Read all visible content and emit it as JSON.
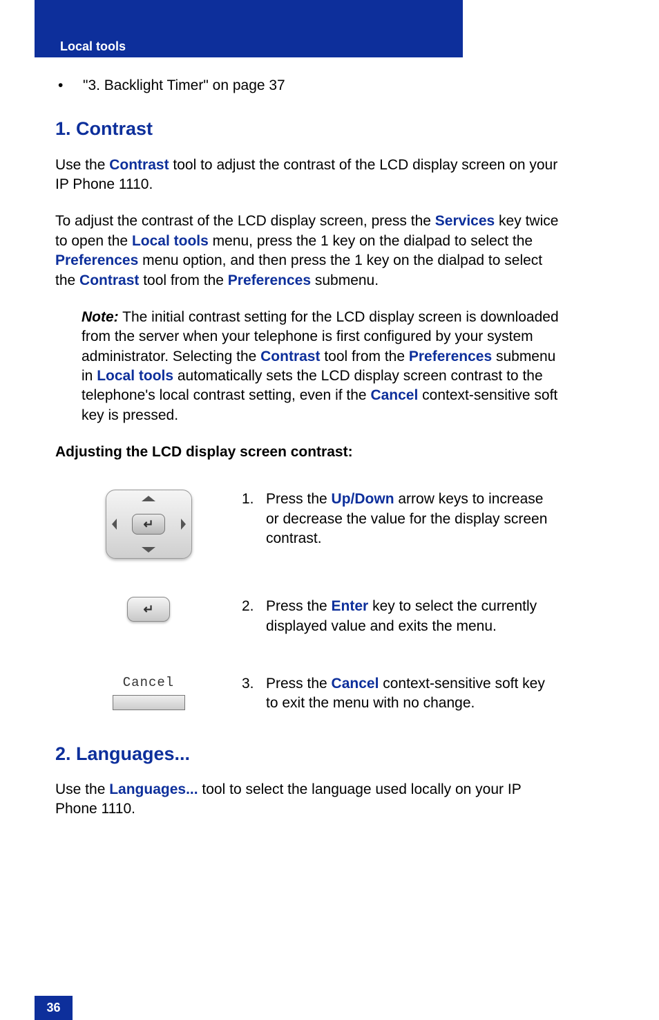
{
  "header": {
    "title": "Local tools"
  },
  "bullet": {
    "text": "\"3. Backlight Timer\" on page 37"
  },
  "section1": {
    "heading": "1. Contrast",
    "p1_a": "Use the ",
    "p1_b": "Contrast",
    "p1_c": " tool to adjust the contrast of the LCD display screen on your IP Phone 1110.",
    "p2_a": "To adjust the contrast of the LCD display screen, press the ",
    "p2_b": "Services",
    "p2_c": " key twice to open the ",
    "p2_d": "Local tools",
    "p2_e": " menu, press the 1 key on the dialpad to select the ",
    "p2_f": "Preferences",
    "p2_g": " menu option, and then press the 1 key on the dialpad to select the ",
    "p2_h": "Contrast",
    "p2_i": " tool from the ",
    "p2_j": "Preferences",
    "p2_k": " submenu.",
    "note_label": "Note:",
    "note_a": " The initial contrast setting for the LCD display screen is downloaded from the server when your telephone is first configured by your system administrator. Selecting the ",
    "note_b": "Contrast",
    "note_c": " tool from the ",
    "note_d": "Preferences",
    "note_e": " submenu in ",
    "note_f": "Local tools",
    "note_g": " automatically sets the LCD display screen contrast to the telephone's local contrast setting, even if the ",
    "note_h": "Cancel",
    "note_i": " context-sensitive soft key is pressed.",
    "procedure_title": "Adjusting the LCD display screen contrast:",
    "steps": {
      "s1": {
        "num": "1.",
        "a": "Press the ",
        "b": "Up/Down",
        "c": " arrow keys to increase or decrease the value for the display screen contrast."
      },
      "s2": {
        "num": "2.",
        "a": "Press the ",
        "b": "Enter",
        "c": " key to select the currently displayed value and exits the menu."
      },
      "s3": {
        "num": "3.",
        "a": "Press the ",
        "b": "Cancel",
        "c": " context-sensitive soft key to exit the menu with no change."
      }
    },
    "cancel_label": "Cancel"
  },
  "section2": {
    "heading": "2. Languages...",
    "p1_a": "Use the ",
    "p1_b": "Languages...",
    "p1_c": " tool to select the language used locally on your IP Phone 1110."
  },
  "page_number": "36"
}
